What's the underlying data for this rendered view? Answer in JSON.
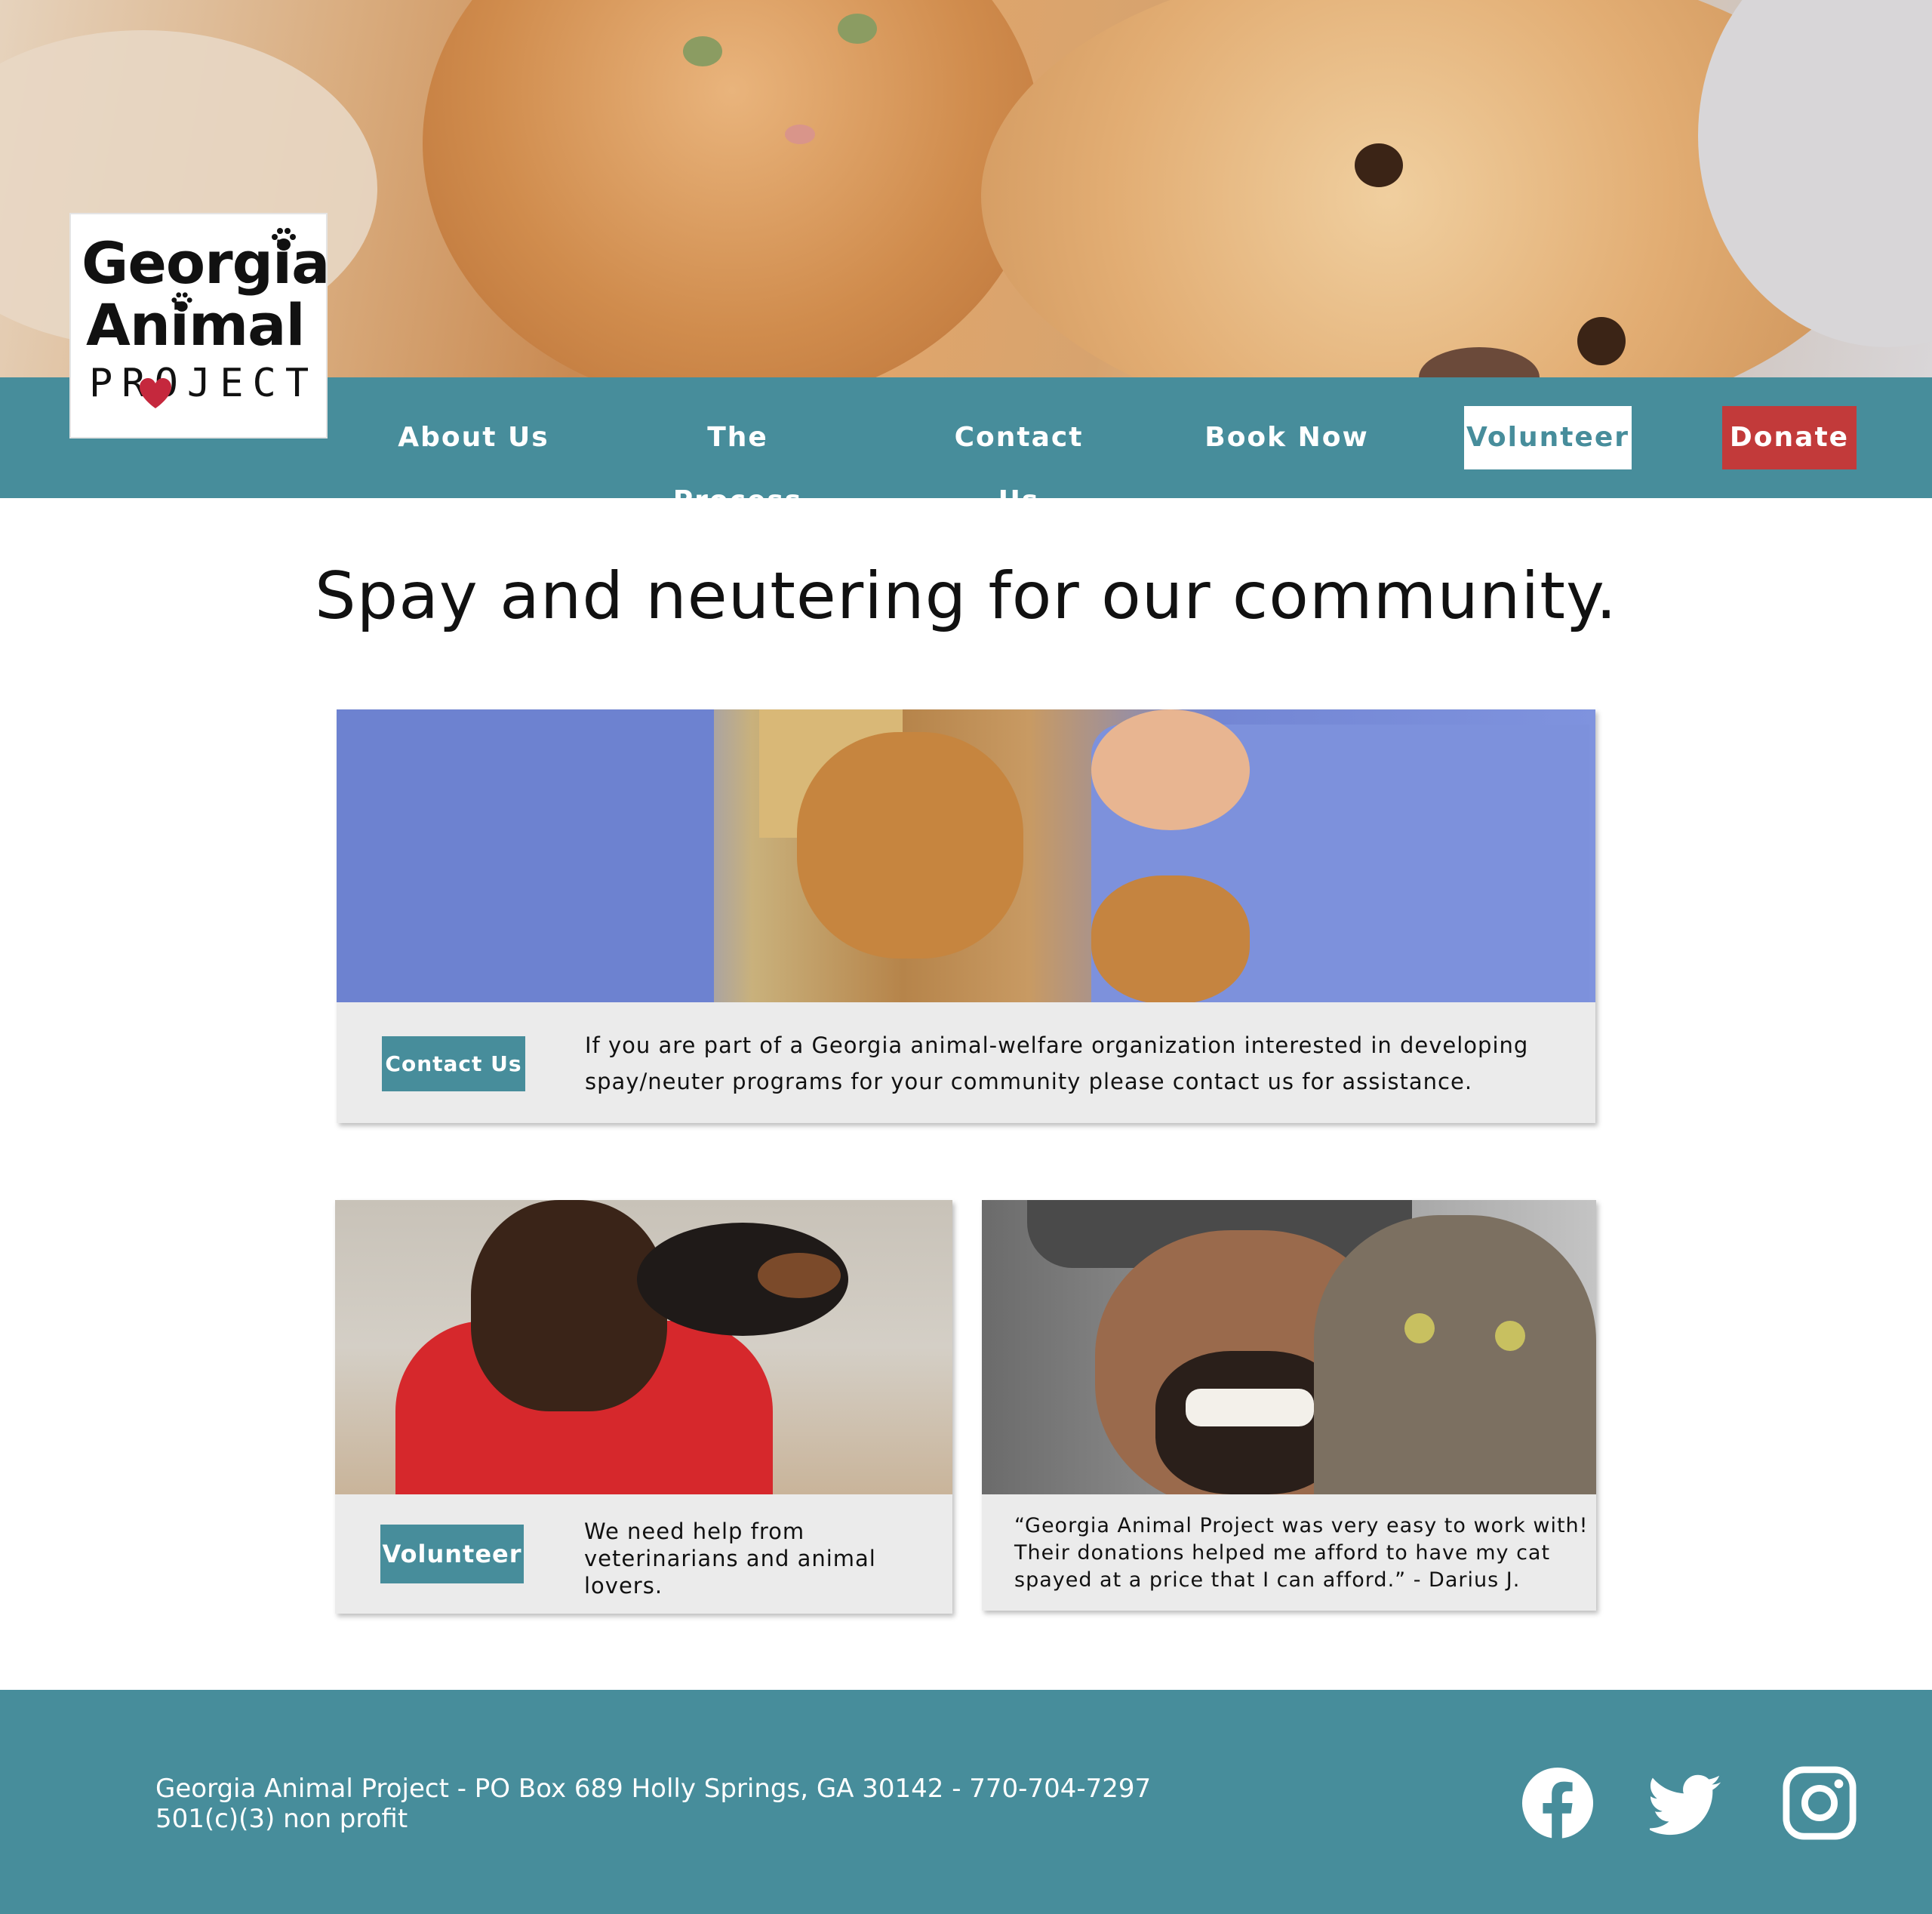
{
  "brand": {
    "logo_line1": "Georgia",
    "logo_line2": "Animal",
    "logo_line3": "PROJECT",
    "heart_color": "#c5283d"
  },
  "nav": {
    "items": [
      {
        "label": "About Us"
      },
      {
        "label": "The Process"
      },
      {
        "label": "Contact Us"
      },
      {
        "label": "Book Now"
      }
    ],
    "volunteer_label": "Volunteer",
    "donate_label": "Donate"
  },
  "main": {
    "headline": "Spay and neutering for our community."
  },
  "cards": {
    "contact": {
      "button_label": "Contact Us",
      "text_line1": "If you are part of a Georgia animal-welfare organization interested in developing",
      "text_line2": "spay/neuter programs for your community please contact us for assistance."
    },
    "volunteer": {
      "button_label": "Volunteer",
      "text_line1": "We need help from",
      "text_line2": "veterinarians and animal",
      "text_line3": "lovers."
    },
    "testimonial": {
      "quote_line1": "“Georgia Animal Project was very easy to work with!",
      "quote_line2": "Their donations helped me afford to have my cat",
      "quote_line3": "spayed at a price that I can afford.” - Darius J."
    }
  },
  "footer": {
    "address": "Georgia Animal Project - PO Box 689 Holly Springs, GA 30142 - 770-704-7297",
    "nonprofit": "501(c)(3) non profit",
    "social_icons": [
      "facebook-icon",
      "twitter-icon",
      "instagram-icon"
    ]
  },
  "colors": {
    "teal": "#478d9b",
    "donate_red": "#c23a3a",
    "card_bg": "#ebebeb"
  }
}
